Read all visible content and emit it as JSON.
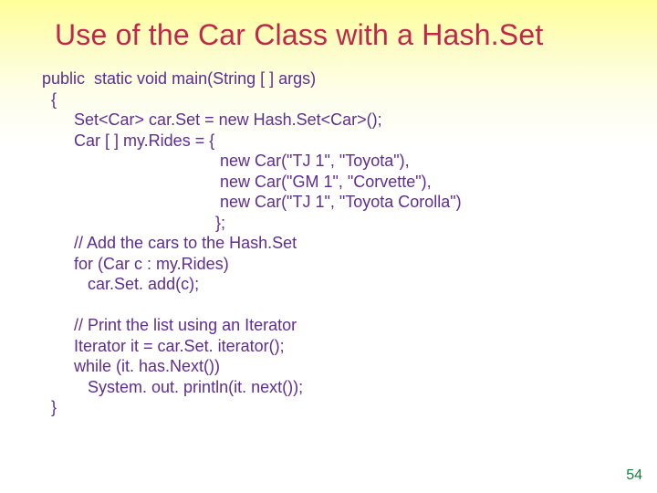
{
  "slide": {
    "title": "Use of the Car Class with a Hash.Set",
    "page_number": "54",
    "code": "public  static void main(String [ ] args)\n  {\n       Set<Car> car.Set = new Hash.Set<Car>();\n       Car [ ] my.Rides = {\n                                       new Car(\"TJ 1\", \"Toyota\"),\n                                       new Car(\"GM 1\", \"Corvette\"),\n                                       new Car(\"TJ 1\", \"Toyota Corolla\")\n                                      };\n       // Add the cars to the Hash.Set\n       for (Car c : my.Rides)\n          car.Set. add(c);\n\n       // Print the list using an Iterator\n       Iterator it = car.Set. iterator();\n       while (it. has.Next())\n          System. out. println(it. next());\n  }"
  }
}
